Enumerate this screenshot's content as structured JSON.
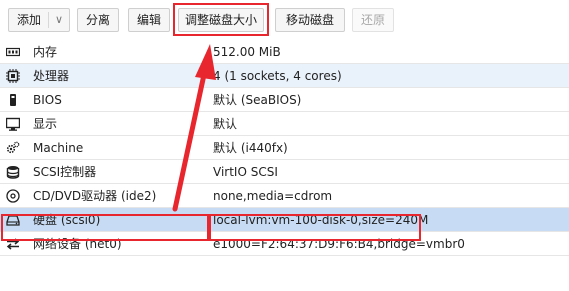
{
  "toolbar": {
    "add_label": "添加",
    "detach_label": "分离",
    "edit_label": "编辑",
    "resize_label": "调整磁盘大小",
    "move_label": "移动磁盘",
    "revert_label": "还原"
  },
  "rows": [
    {
      "icon": "memory-icon",
      "name": "内存",
      "value": "512.00 MiB"
    },
    {
      "icon": "processor-icon",
      "name": "处理器",
      "value": "4 (1 sockets, 4 cores)"
    },
    {
      "icon": "bios-icon",
      "name": "BIOS",
      "value": "默认 (SeaBIOS)"
    },
    {
      "icon": "display-icon",
      "name": "显示",
      "value": "默认"
    },
    {
      "icon": "machine-icon",
      "name": "Machine",
      "value": "默认 (i440fx)"
    },
    {
      "icon": "storage-icon",
      "name": "SCSI控制器",
      "value": "VirtIO SCSI"
    },
    {
      "icon": "cdrom-icon",
      "name": "CD/DVD驱动器 (ide2)",
      "value": "none,media=cdrom"
    },
    {
      "icon": "harddisk-icon",
      "name": "硬盘 (scsi0)",
      "value": "local-lvm:vm-100-disk-0,size=240M"
    },
    {
      "icon": "network-icon",
      "name": "网络设备 (net0)",
      "value": "e1000=F2:64:37:D9:F6:B4,bridge=vmbr0"
    }
  ],
  "colors": {
    "highlight": "#e8262e",
    "selected_row": "#c7dcf4",
    "alt_row": "#e9f1fb"
  }
}
